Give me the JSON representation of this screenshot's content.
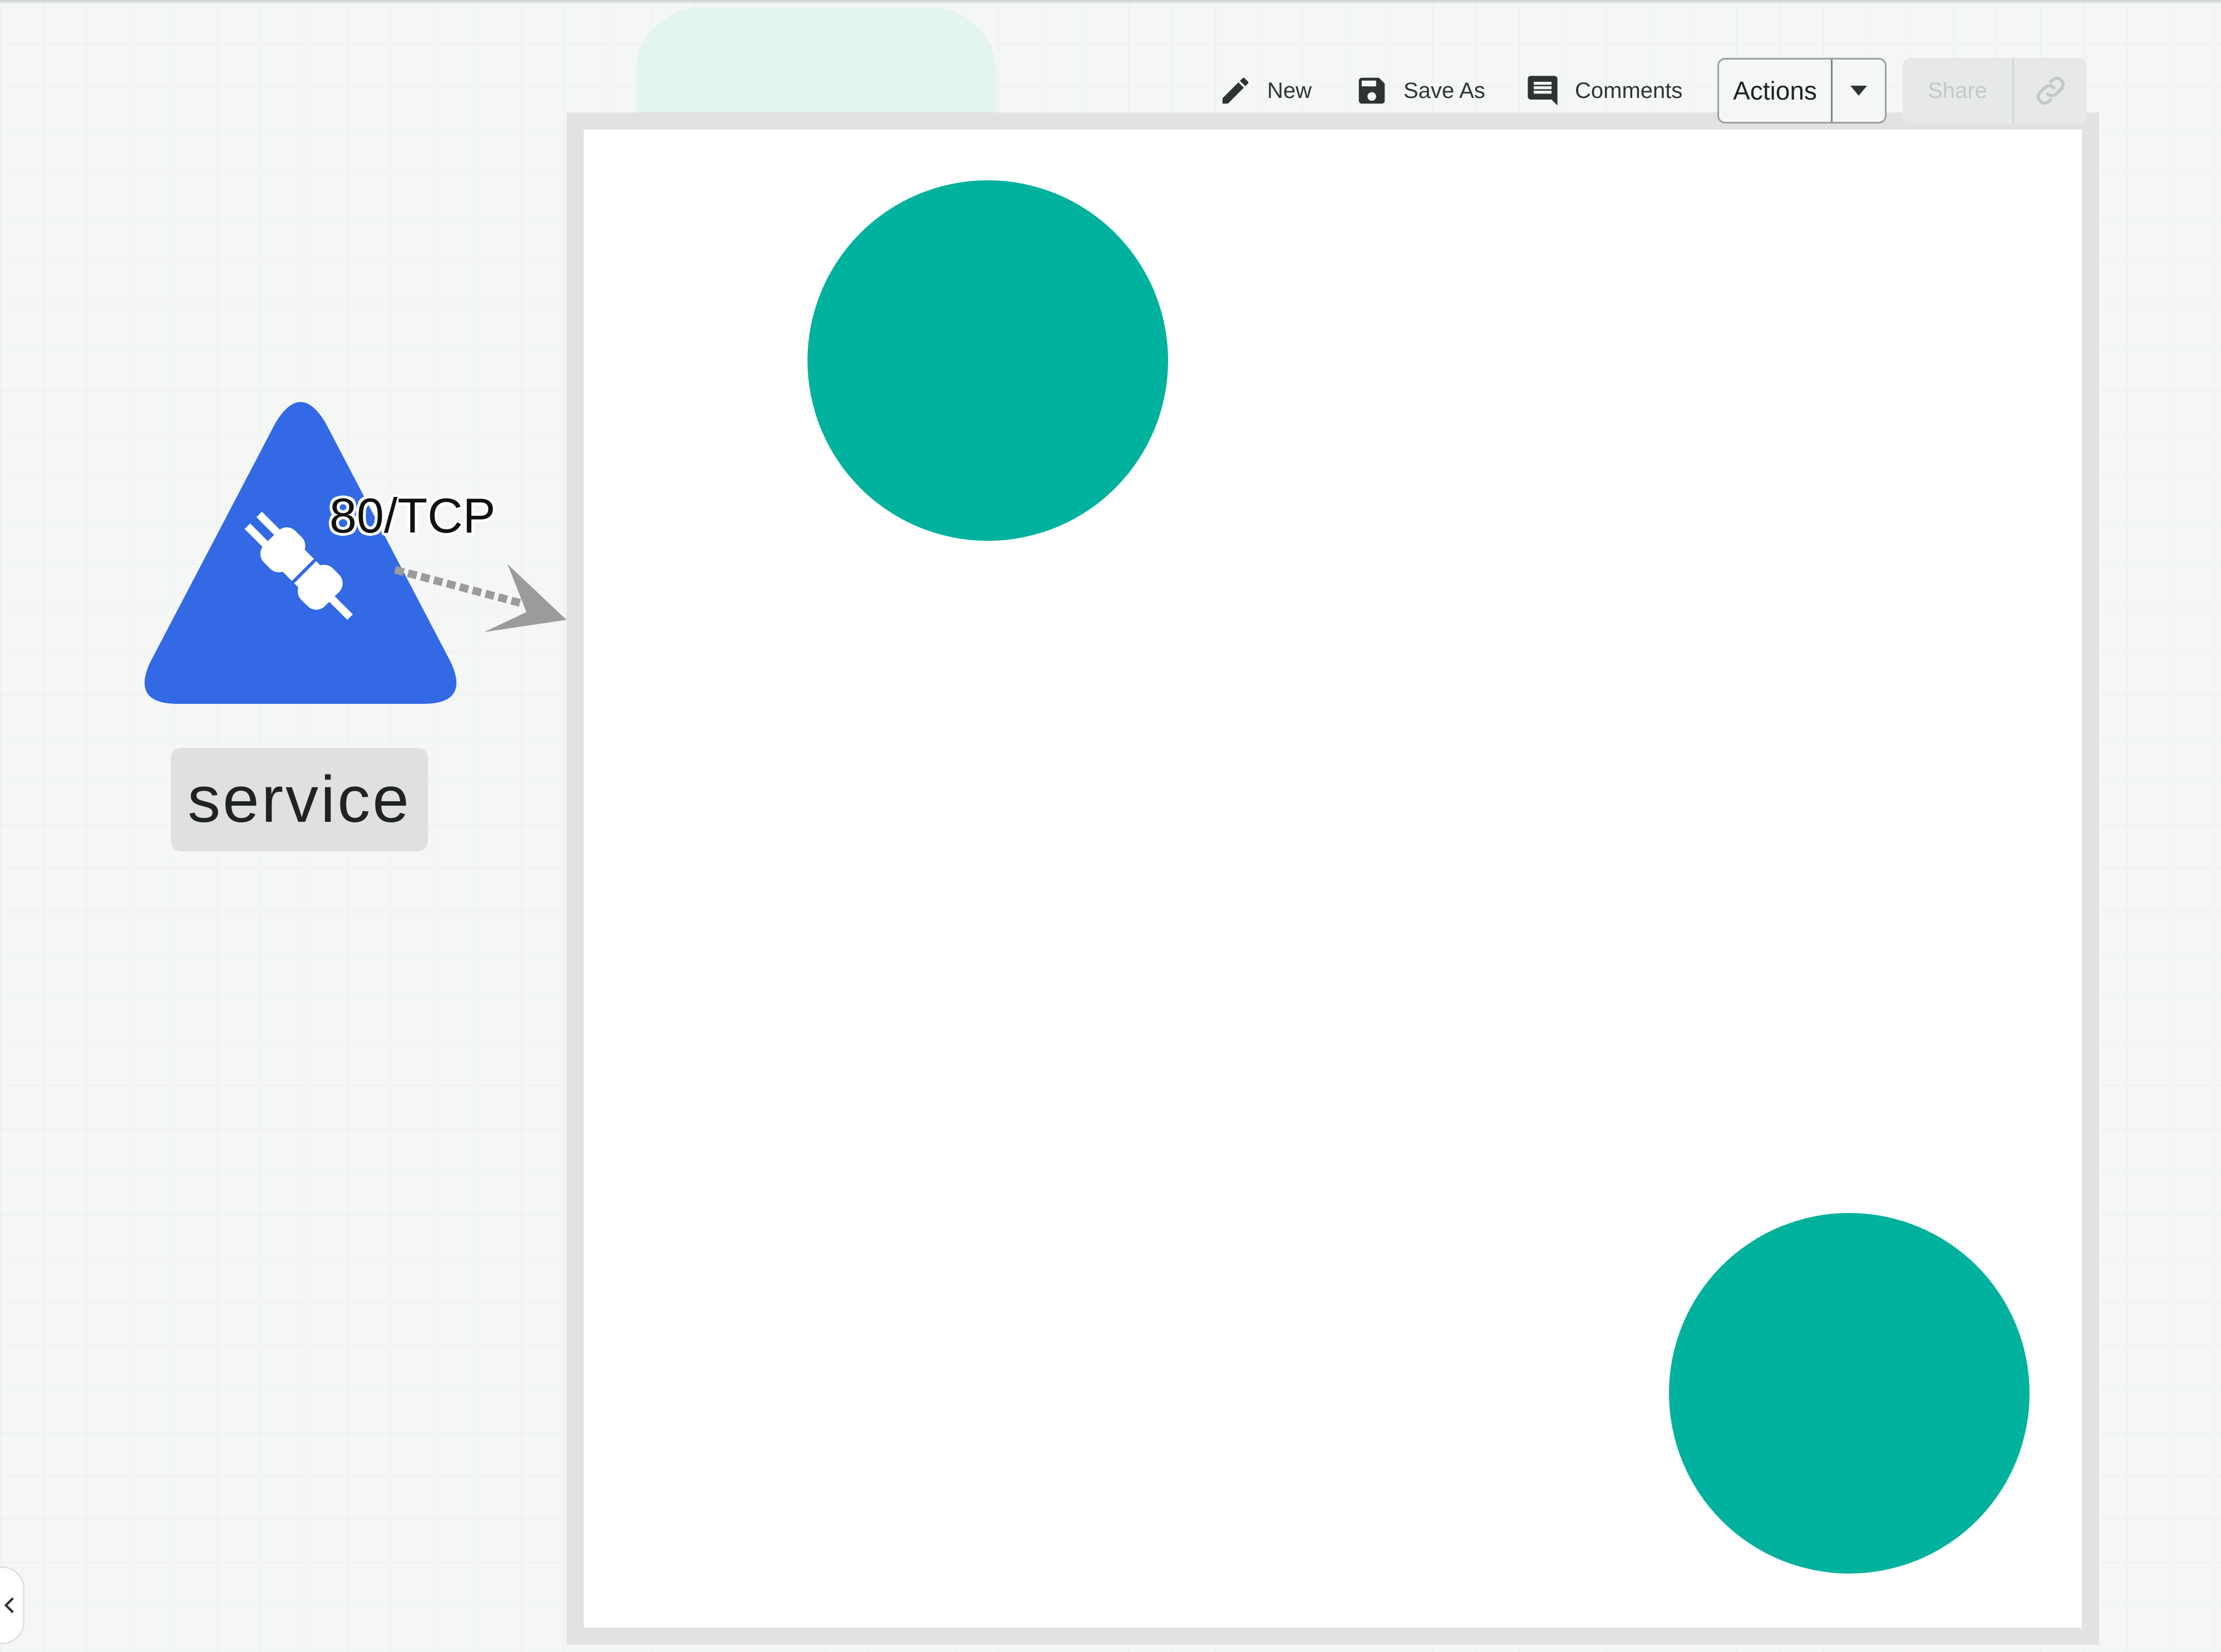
{
  "toolbar": {
    "new_label": "New",
    "save_as_label": "Save As",
    "comments_label": "Comments",
    "actions_label": "Actions",
    "share_label": "Share"
  },
  "diagram": {
    "service_label": "service",
    "edge_label": "80/TCP"
  },
  "icons": {
    "new": "pencil-icon",
    "save_as": "floppy-disk-icon",
    "comments": "comment-icon",
    "actions_dropdown": "caret-down-icon",
    "share_link": "link-icon",
    "service": "plug-icon",
    "collapse": "chevron-left-icon"
  },
  "colors": {
    "pod": "#00b29d",
    "service": "#3369e5",
    "canvas_border": "#e1e2e1",
    "ghost": "#e4f4f1"
  }
}
